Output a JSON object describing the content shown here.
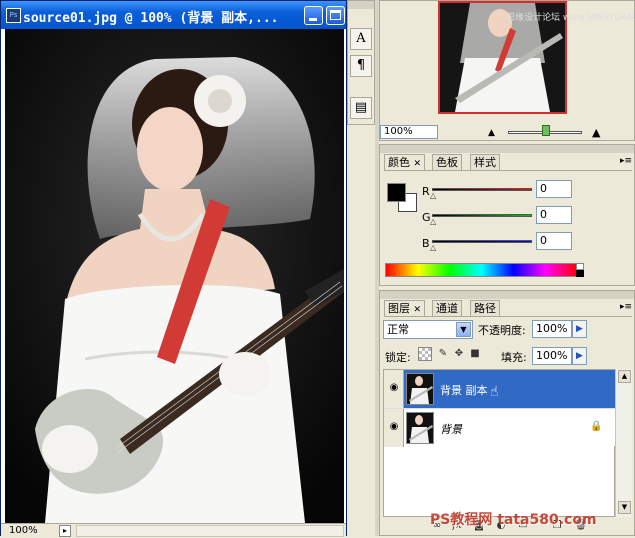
{
  "document": {
    "title": "source01.jpg @ 100% (背景 副本,...",
    "zoom": "100%"
  },
  "navigator": {
    "zoom": "100%",
    "watermark": "思缘设计论坛 www.MISSYUAN.COM"
  },
  "color_panel": {
    "tabs": [
      "颜色",
      "色板",
      "样式"
    ],
    "channels": [
      {
        "label": "R",
        "value": "0"
      },
      {
        "label": "G",
        "value": "0"
      },
      {
        "label": "B",
        "value": "0"
      }
    ]
  },
  "layers_panel": {
    "tabs": [
      "图层",
      "通道",
      "路径"
    ],
    "blend_mode": "正常",
    "opacity_label": "不透明度:",
    "opacity": "100%",
    "lock_label": "锁定:",
    "fill_label": "填充:",
    "fill": "100%",
    "layers": [
      {
        "name": "背景 副本",
        "selected": true
      },
      {
        "name": "背景",
        "selected": false
      }
    ]
  },
  "footer_watermark": "PS教程网 tata580.com",
  "colors": {
    "selection": "#316ac5",
    "titlebar": "#0553d0"
  }
}
